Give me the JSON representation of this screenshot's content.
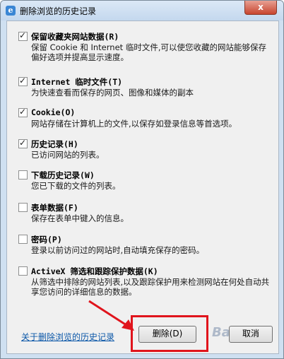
{
  "window": {
    "title": "删除浏览的历史记录",
    "close_label": "x"
  },
  "options": [
    {
      "title": "保留收藏夹网站数据(R)",
      "desc": "保留 Cookie 和 Internet 临时文件,可以使您收藏的网站能够保存偏好选项并提高显示速度。",
      "checked": true
    },
    {
      "title": "Internet 临时文件(T)",
      "desc": "为快速查看而保存的网页、图像和媒体的副本",
      "checked": true
    },
    {
      "title": "Cookie(O)",
      "desc": "网站存储在计算机上的文件,以保存如登录信息等首选项。",
      "checked": true
    },
    {
      "title": "历史记录(H)",
      "desc": "已访问网站的列表。",
      "checked": true
    },
    {
      "title": "下载历史记录(W)",
      "desc": "您已下载的文件的列表。",
      "checked": false
    },
    {
      "title": "表单数据(F)",
      "desc": "保存在表单中键入的信息。",
      "checked": false
    },
    {
      "title": "密码(P)",
      "desc": "登录以前访问过的网站时,自动填充保存的密码。",
      "checked": false
    },
    {
      "title": "ActiveX 筛选和跟踪保护数据(K)",
      "desc": "从筛选中排除的网站列表,以及跟踪保护用来检测网站在何处自动共享您访问的详细信息的数据。",
      "checked": false
    }
  ],
  "footer": {
    "link": "关于删除浏览的历史记录",
    "delete_label": "删除(D)",
    "cancel_label": "取消"
  },
  "annotation": {
    "highlight_color": "#e0141c",
    "watermark": "Baidu"
  }
}
